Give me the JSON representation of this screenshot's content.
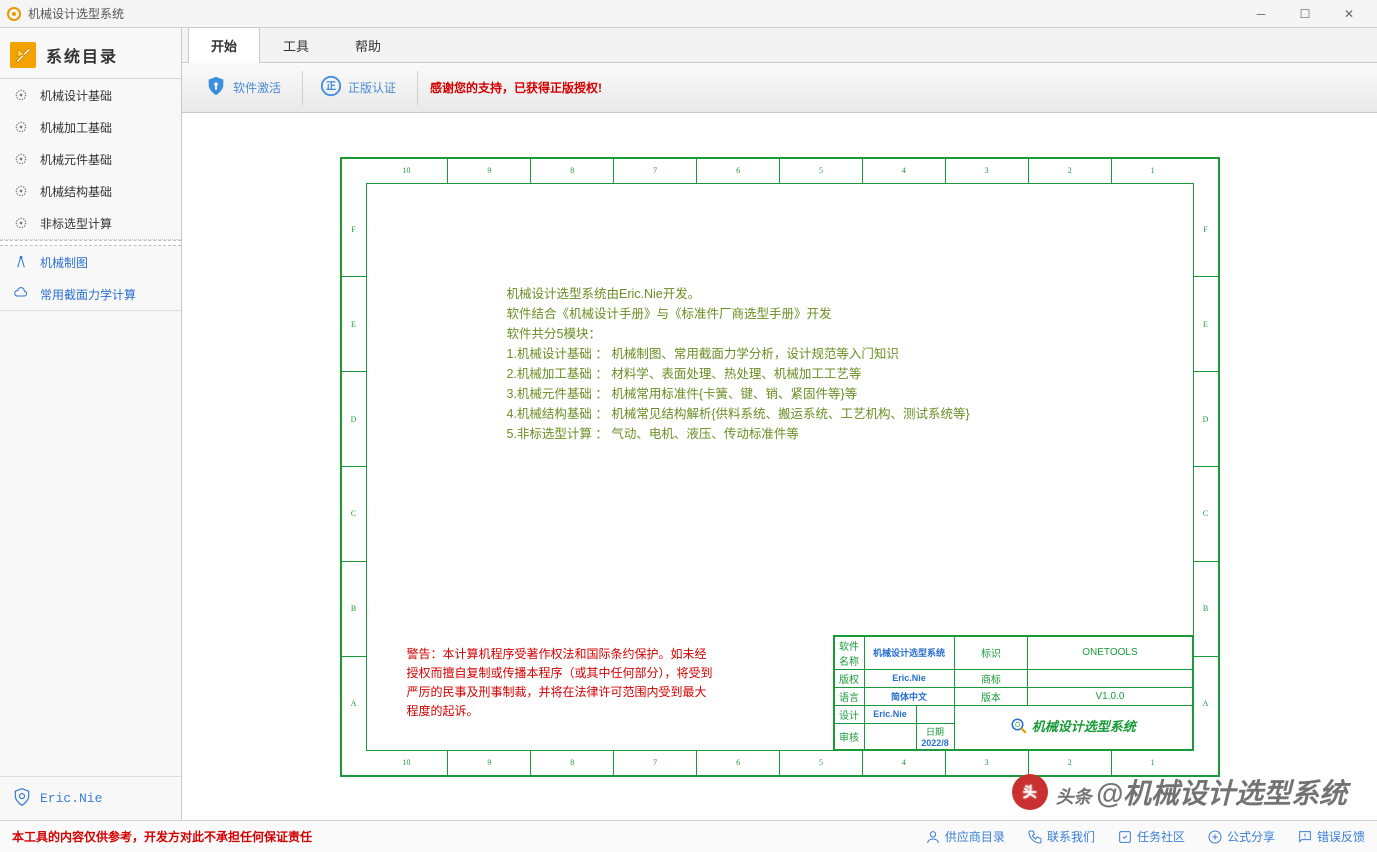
{
  "window": {
    "title": "机械设计选型系统"
  },
  "sidebar": {
    "header": "系统目录",
    "groupA": [
      {
        "label": "机械设计基础"
      },
      {
        "label": "机械加工基础"
      },
      {
        "label": "机械元件基础"
      },
      {
        "label": "机械结构基础"
      },
      {
        "label": "非标选型计算"
      }
    ],
    "groupB": [
      {
        "label": "机械制图"
      },
      {
        "label": "常用截面力学计算"
      }
    ],
    "footer": "Eric.Nie"
  },
  "tabs": [
    {
      "label": "开始",
      "active": true
    },
    {
      "label": "工具"
    },
    {
      "label": "帮助"
    }
  ],
  "ribbon": {
    "activate": "软件激活",
    "verify": "正版认证",
    "message": "感谢您的支持，已获得正版授权!"
  },
  "drawing": {
    "cols": [
      "10",
      "9",
      "8",
      "7",
      "6",
      "5",
      "4",
      "3",
      "2",
      "1"
    ],
    "rows": [
      "F",
      "E",
      "D",
      "C",
      "B",
      "A"
    ],
    "desc": [
      "机械设计选型系统由Eric.Nie开发。",
      "软件结合《机械设计手册》与《标准件厂商选型手册》开发",
      "软件共分5模块：",
      "1.机械设计基础 ： 机械制图、常用截面力学分析，设计规范等入门知识",
      "2.机械加工基础 ： 材料学、表面处理、热处理、机械加工工艺等",
      "3.机械元件基础 ： 机械常用标准件{卡簧、键、销、紧固件等}等",
      "4.机械结构基础 ： 机械常见结构解析{供料系统、搬运系统、工艺机构、测试系统等}",
      "5.非标选型计算 ： 气动、电机、液压、传动标准件等"
    ],
    "warning": "警告：本计算机程序受著作权法和国际条约保护。如未经授权而擅自复制或传播本程序（或其中任何部分），将受到严厉的民事及刑事制裁，并将在法律许可范围内受到最大程度的起诉。",
    "titleblock": {
      "softname_l": "软件名称",
      "softname_v": "机械设计选型系统",
      "mark_l": "标识",
      "mark_v": "ONETOOLS",
      "copyright_l": "版权",
      "copyright_v": "Eric.Nie",
      "trademark_l": "商标",
      "trademark_v": "",
      "lang_l": "语言",
      "lang_v": "简体中文",
      "ver_l": "版本",
      "ver_v": "V1.0.0",
      "design_l": "设计",
      "design_v": "Eric.Nie",
      "review_l": "审核",
      "review_v": "",
      "date_l": "日期",
      "date_v": "2022/8",
      "logo_text": "机械设计选型系统"
    }
  },
  "status": {
    "disclaimer": "本工具的内容仅供参考，开发方对此不承担任何保证责任",
    "links": [
      "供应商目录",
      "联系我们",
      "任务社区",
      "公式分享",
      "错误反馈"
    ],
    "watermark_pre": "头条",
    "watermark": "@机械设计选型系统"
  }
}
